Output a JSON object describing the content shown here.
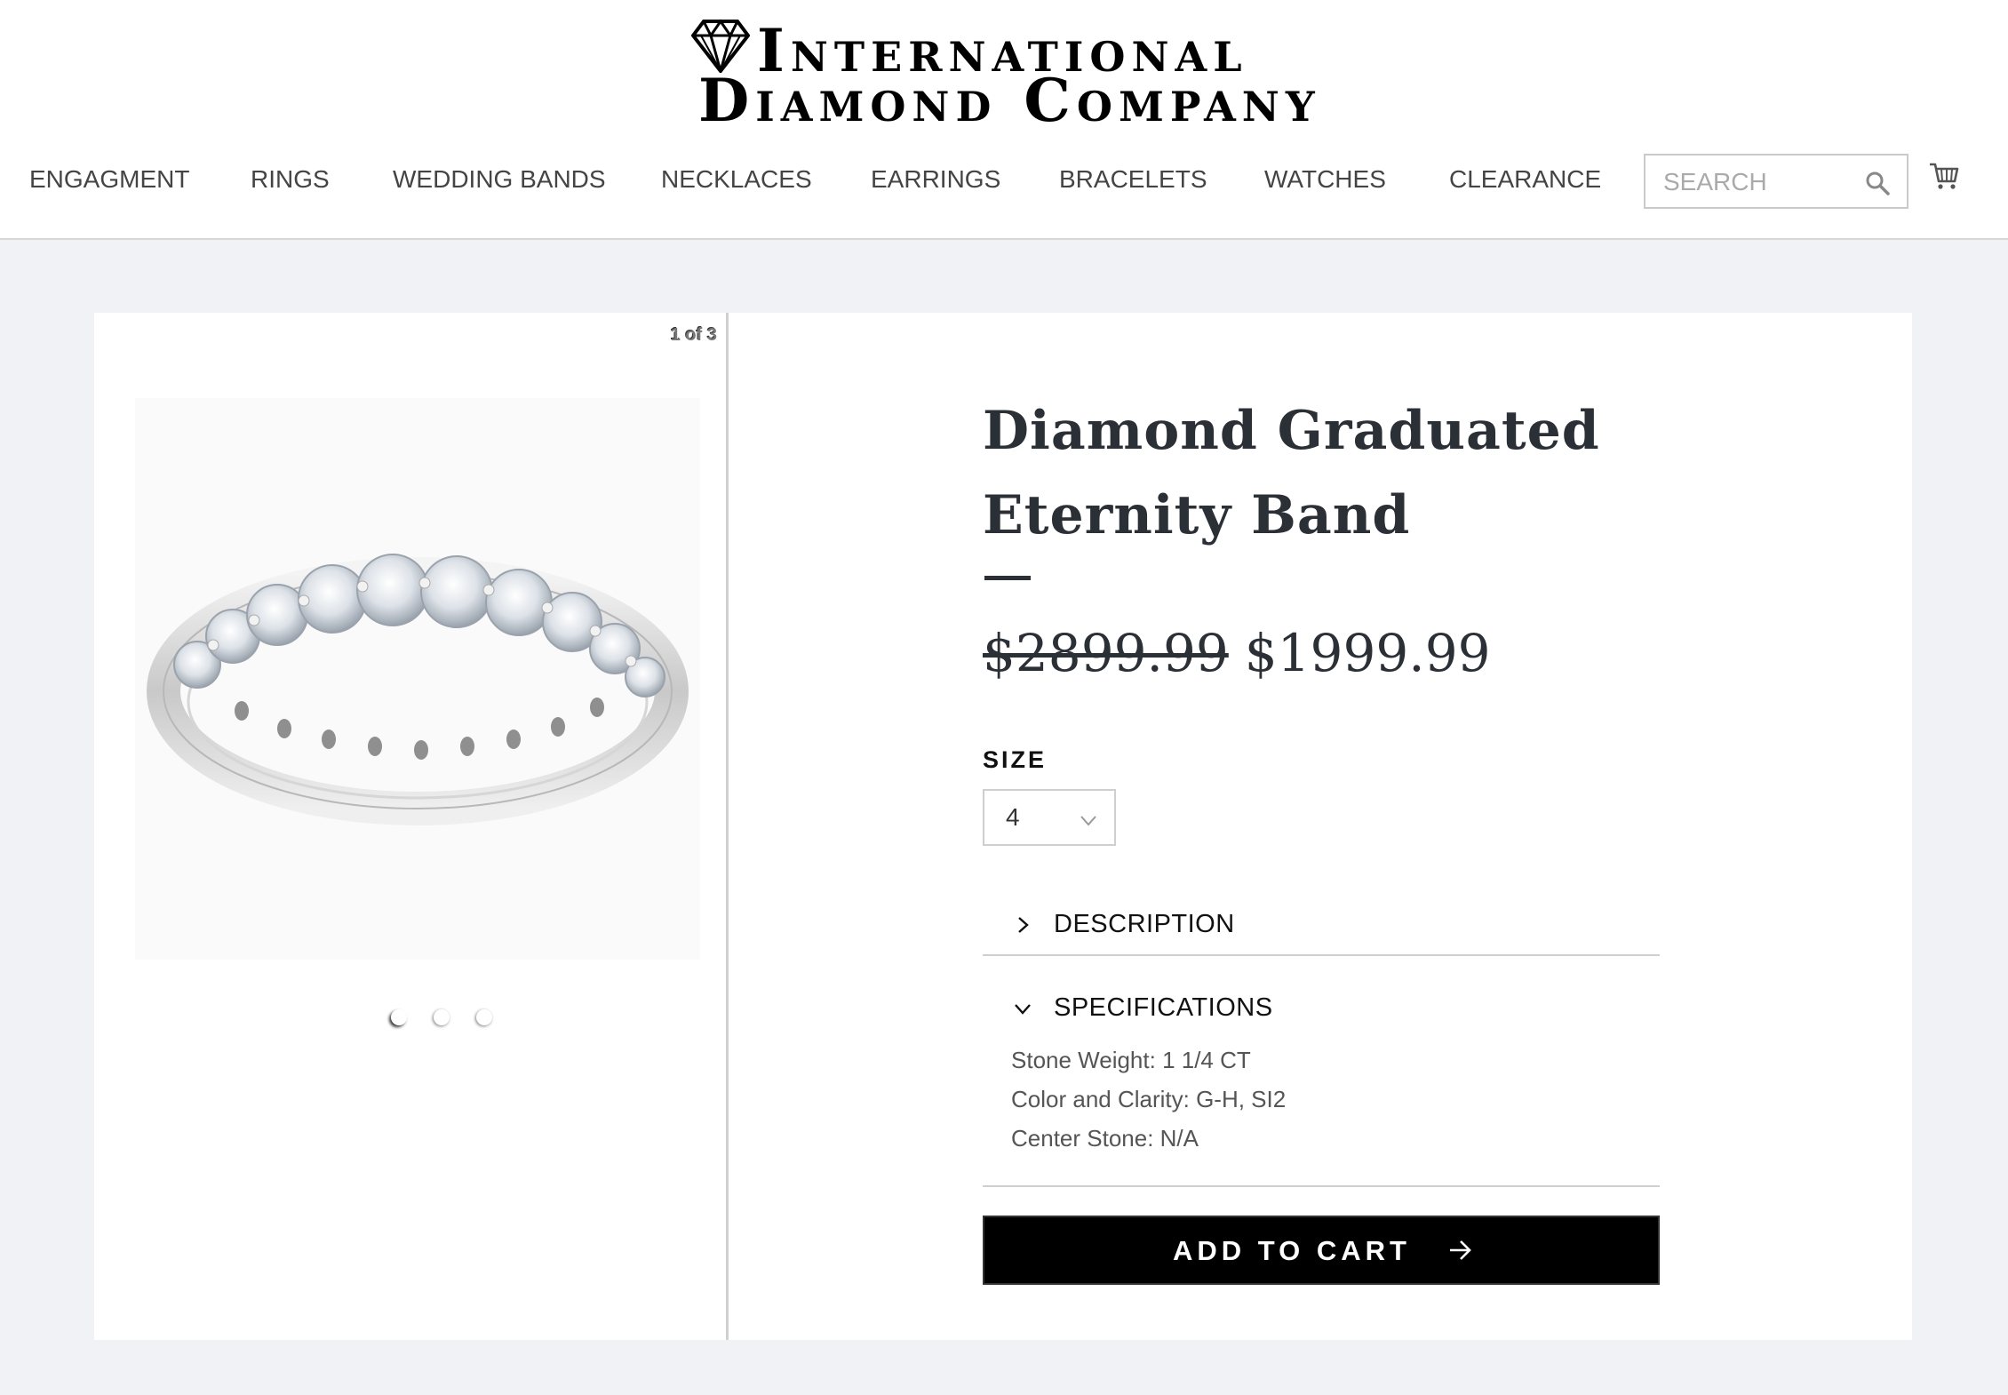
{
  "brand": {
    "line1": "International",
    "line2": "Diamond Company"
  },
  "nav": {
    "items": [
      {
        "label": "ENGAGMENT"
      },
      {
        "label": "RINGS"
      },
      {
        "label": "WEDDING BANDS"
      },
      {
        "label": "NECKLACES"
      },
      {
        "label": "EARRINGS"
      },
      {
        "label": "BRACELETS"
      },
      {
        "label": "WATCHES"
      },
      {
        "label": "CLEARANCE"
      }
    ]
  },
  "search": {
    "placeholder": "SEARCH",
    "icon": "search-icon"
  },
  "cart": {
    "icon": "cart-icon"
  },
  "gallery": {
    "counter": "1 of 3",
    "current_slide": 1,
    "total_slides": 3
  },
  "product": {
    "title": "Diamond Graduated Eternity Band",
    "old_price": "$2899.99",
    "price": "$1999.99",
    "size_label": "SIZE",
    "size_value": "4",
    "accordion": {
      "description_label": "DESCRIPTION",
      "description_expanded": false,
      "specifications_label": "SPECIFICATIONS",
      "specifications_expanded": true,
      "specs": [
        "Stone Weight: 1 1/4 CT",
        "Color and Clarity: G-H, SI2",
        "Center Stone: N/A"
      ]
    },
    "add_to_cart_label": "ADD TO CART"
  },
  "colors": {
    "page_bg": "#f1f2f5",
    "title": "#2b2f36",
    "button": "#000000"
  }
}
